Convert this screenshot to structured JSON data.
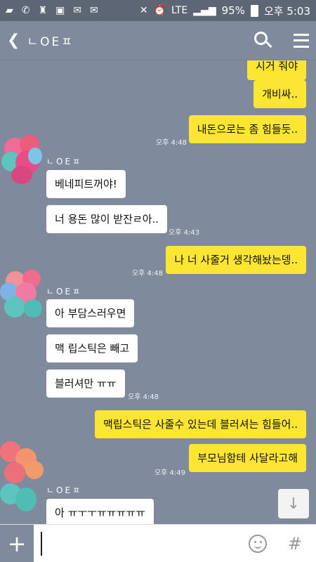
{
  "status_bar": {
    "battery": "95%",
    "time": "오후 5:03",
    "network": "LTE"
  },
  "header": {
    "back_glyph": "❮",
    "title": "ㄴOEㅍ"
  },
  "messages": {
    "m1": "시거 줘야",
    "m2": "개비싸..",
    "m3": "내돈으로는 좀 힘들듯..",
    "m3_time": "오후 4:48",
    "sender1": "ㄴOEㅍ",
    "m4": "베네피트꺼야!",
    "m5": "너 용돈 많이 받잔ㄹ아..",
    "m5_time": "오후 4:43",
    "m6": "나 너 사줄거 생각해놨는뎅..",
    "m6_time": "오후 4:48",
    "sender2": "ㄴOEㅍ",
    "m7": "아 부담스러우면",
    "m8": "맥 립스틱은 빼고",
    "m9": "블러셔만 ㅠㅠ",
    "m9_time": "오후 4:48",
    "m10": "맥립스틱은 사줄수 있는데 블러셔는 힘들어..",
    "m11": "부모님함테 사달라고해",
    "m11_time": "오후 4:49",
    "sender3": "ㄴOEㅍ",
    "m12": "아 ㅠㅜㅜㅠㅠㅠㅠㅠ"
  },
  "input": {
    "plus_glyph": "+",
    "hash_glyph": "#",
    "scroll_glyph": "↓"
  },
  "colors": {
    "background": "#7f8a9c",
    "my_bubble": "#fde534",
    "their_bubble": "#ffffff"
  }
}
